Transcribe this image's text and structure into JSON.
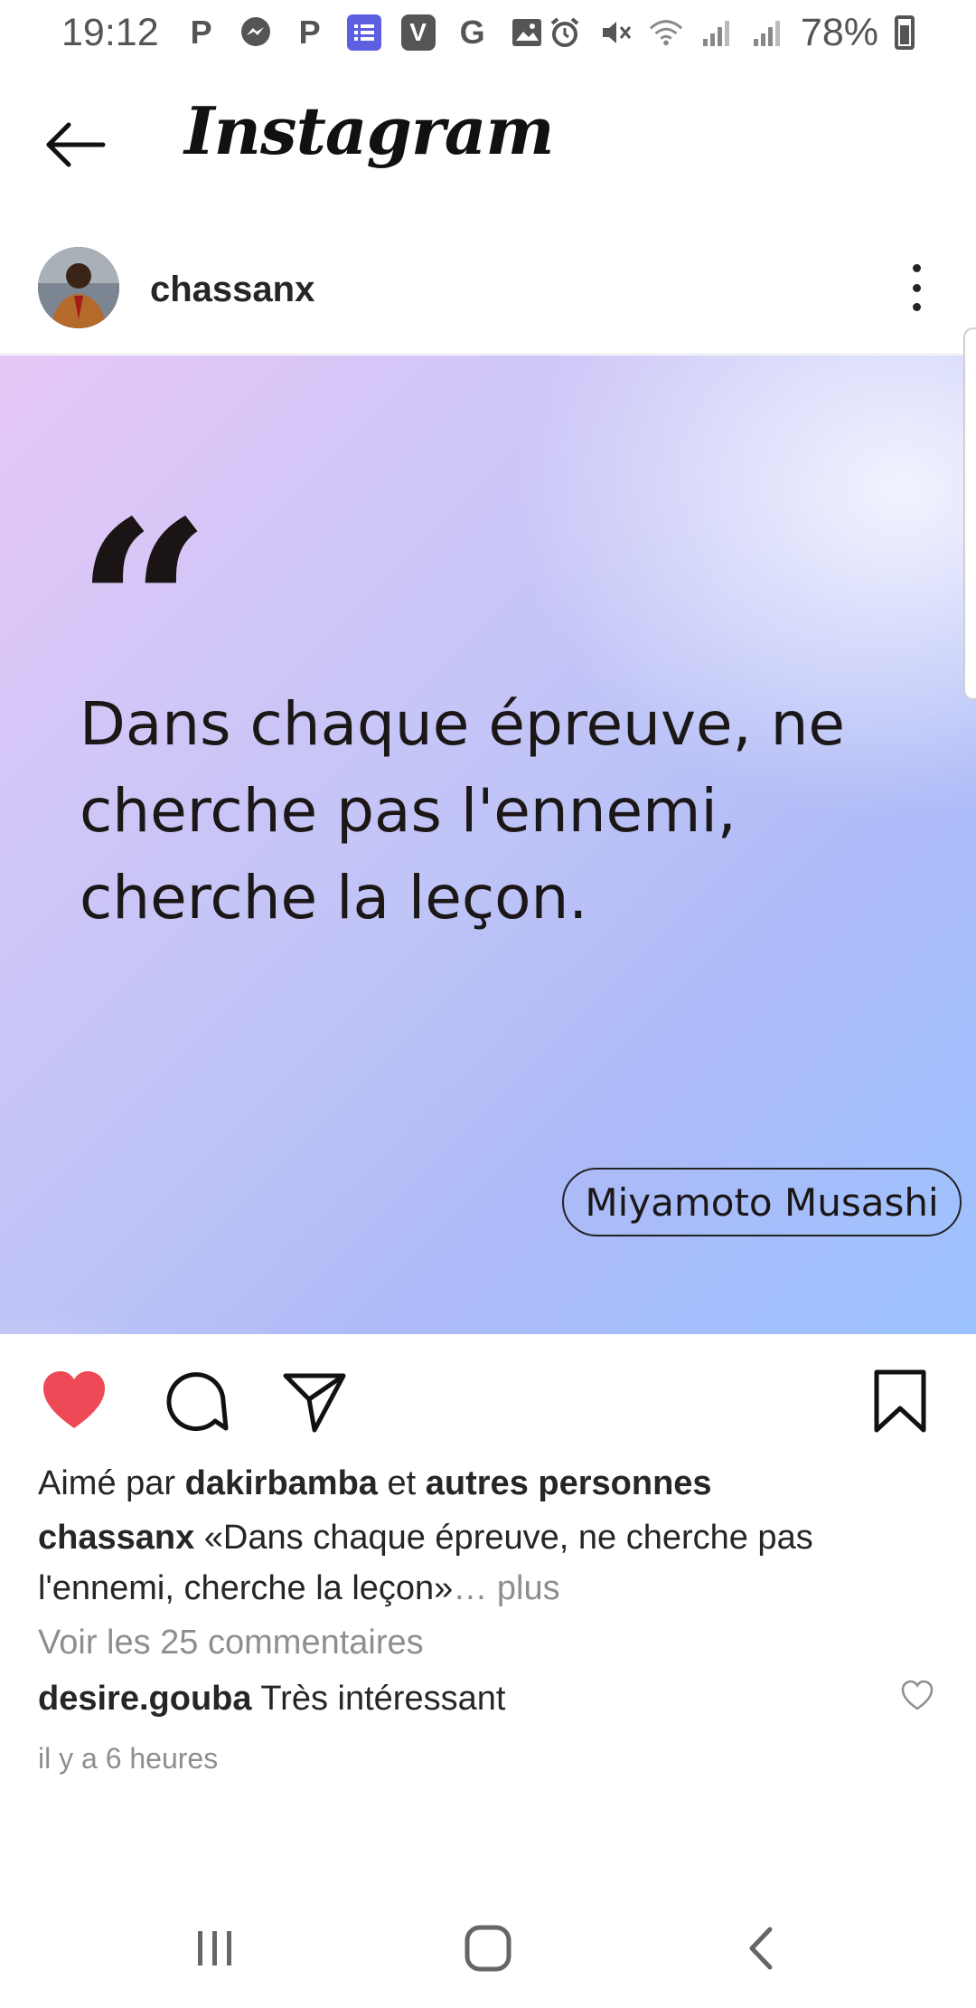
{
  "status_bar": {
    "time": "19:12",
    "battery": "78%",
    "left_icons": [
      "P",
      "messenger",
      "P",
      "tasks",
      "V",
      "G",
      "image"
    ],
    "right_icons": [
      "alarm-icon",
      "mute-icon",
      "wifi-icon",
      "signal-icon",
      "signal-icon",
      "battery-icon"
    ]
  },
  "header": {
    "title": "Instagram"
  },
  "post": {
    "username": "chassanx",
    "image": {
      "quote_mark": "“",
      "quote": "Dans chaque épreuve, ne cherche pas l'ennemi, cherche la leçon.",
      "author": "Miyamoto Musashi",
      "colors": {
        "gradient_start": "#e6c6f7",
        "gradient_end": "#9cc3ff"
      }
    },
    "liked": true,
    "like_color": "#ed4956",
    "likes_prefix": "Aimé par",
    "likes_user": "dakirbamba",
    "likes_connector": "et",
    "likes_others": "autres personnes",
    "caption_user": "chassanx",
    "caption_text": "«Dans chaque épreuve, ne cherche pas l'ennemi, cherche la leçon»",
    "caption_more": "… plus",
    "view_comments": "Voir les 25 commentaires",
    "comment": {
      "user": "desire.gouba",
      "text": "Très intéressant"
    },
    "time_ago": "il y a 6 heures"
  }
}
